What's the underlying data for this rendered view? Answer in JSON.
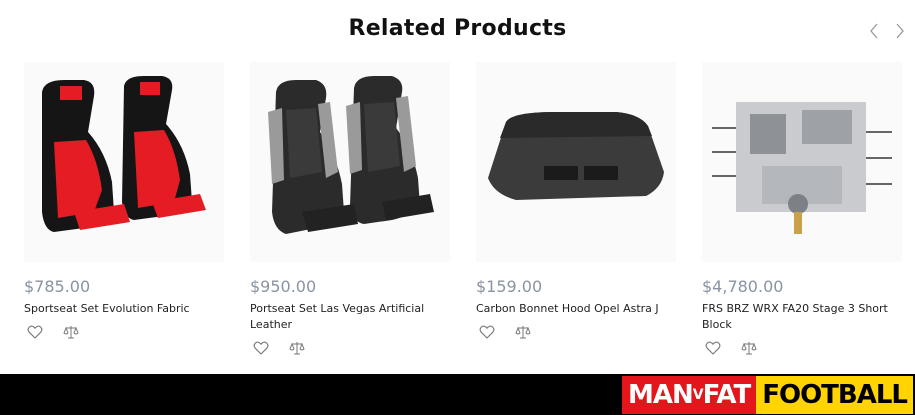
{
  "section": {
    "title": "Related Products"
  },
  "nav": {
    "prev_icon": "chevron-left-icon",
    "next_icon": "chevron-right-icon"
  },
  "products": [
    {
      "price": "$785.00",
      "name": "Sportseat Set Evolution Fabric",
      "image": "racing-seats-red-black"
    },
    {
      "price": "$950.00",
      "name": "Portseat Set Las Vegas Artificial Leather",
      "image": "racing-seats-black-grey-quilted"
    },
    {
      "price": "$159.00",
      "name": "Carbon Bonnet Hood Opel Astra J",
      "image": "carbon-hood"
    },
    {
      "price": "$4,780.00",
      "name": "FRS BRZ WRX FA20 Stage 3 Short Block",
      "image": "engine-short-block"
    }
  ],
  "actions": {
    "wishlist_icon": "heart-icon",
    "compare_icon": "compare-scale-icon"
  },
  "footer": {
    "logo_part1": "MAN",
    "logo_part2": "V",
    "logo_part3": "FAT",
    "logo_part4": "FOOTBALL",
    "brand_red": "#e3161b",
    "brand_yellow": "#ffd400"
  }
}
